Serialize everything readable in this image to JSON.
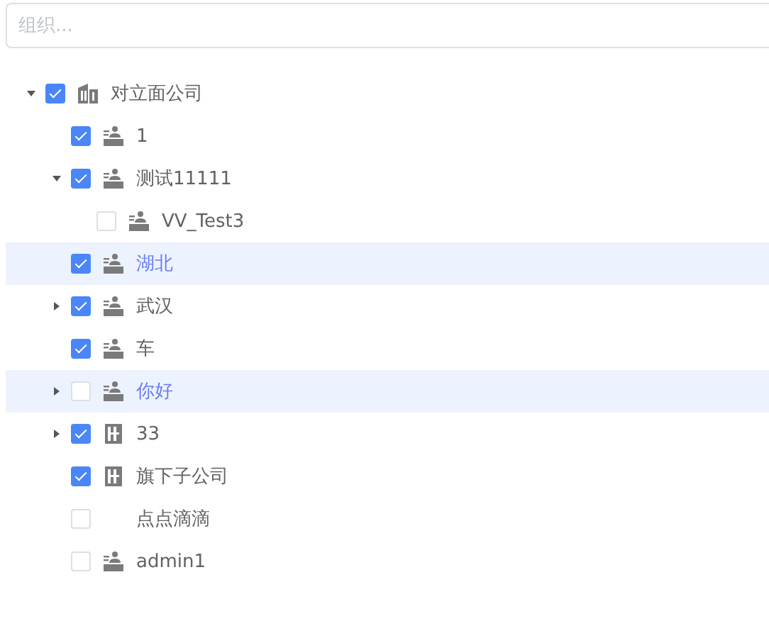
{
  "search": {
    "placeholder": "组织..."
  },
  "tree": [
    {
      "label": "对立面公司",
      "kind": "company",
      "checked": true,
      "selected": false,
      "expanded": true,
      "children": [
        {
          "label": "1",
          "kind": "department",
          "checked": true,
          "selected": false
        },
        {
          "label": "测试11111",
          "kind": "department",
          "checked": true,
          "selected": false,
          "expanded": true,
          "children": [
            {
              "label": "VV_Test3",
              "kind": "department",
              "checked": false,
              "selected": false
            }
          ]
        },
        {
          "label": "湖北",
          "kind": "department",
          "checked": true,
          "selected": true
        },
        {
          "label": "武汉",
          "kind": "department",
          "checked": true,
          "selected": false,
          "expanded": false
        },
        {
          "label": "车",
          "kind": "department",
          "checked": true,
          "selected": false
        },
        {
          "label": "你好",
          "kind": "department",
          "checked": false,
          "selected": true,
          "expanded": false
        },
        {
          "label": "33",
          "kind": "building",
          "checked": true,
          "selected": false,
          "expanded": false
        },
        {
          "label": "旗下子公司",
          "kind": "building",
          "checked": true,
          "selected": false
        },
        {
          "label": "点点滴滴",
          "kind": "none",
          "checked": false,
          "selected": false
        },
        {
          "label": "admin1",
          "kind": "department",
          "checked": false,
          "selected": false
        }
      ]
    }
  ]
}
